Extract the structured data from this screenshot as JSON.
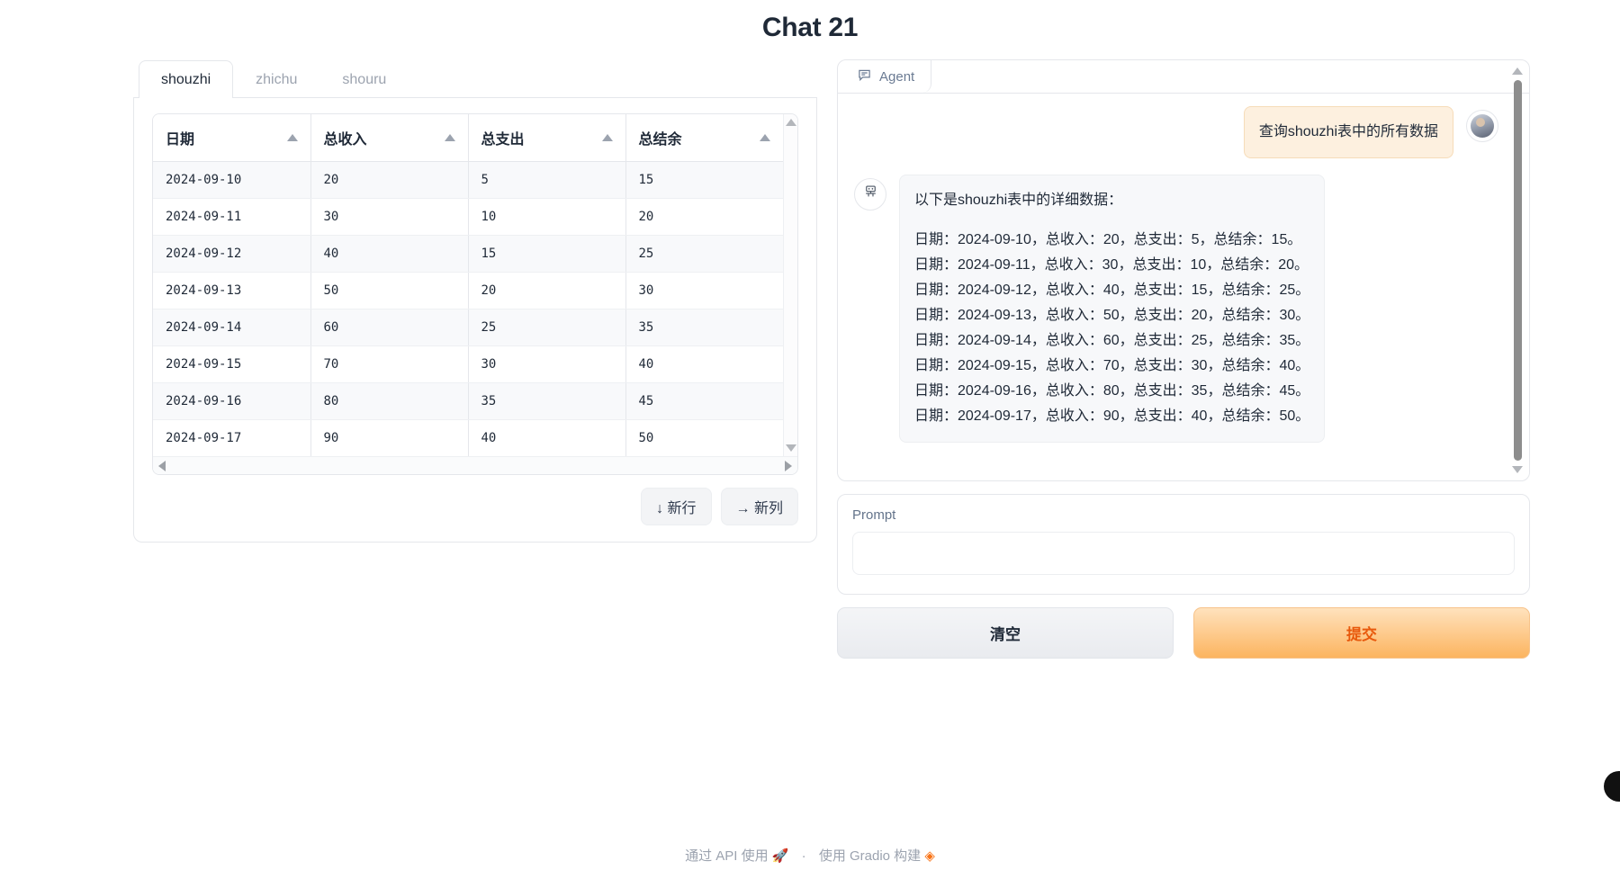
{
  "app": {
    "title": "Chat 21"
  },
  "table_panel": {
    "tabs": [
      {
        "label": "shouzhi",
        "active": true
      },
      {
        "label": "zhichu",
        "active": false
      },
      {
        "label": "shouru",
        "active": false
      }
    ],
    "dataframe": {
      "columns": [
        "日期",
        "总收入",
        "总支出",
        "总结余"
      ],
      "rows": [
        [
          "2024-09-10",
          "20",
          "5",
          "15"
        ],
        [
          "2024-09-11",
          "30",
          "10",
          "20"
        ],
        [
          "2024-09-12",
          "40",
          "15",
          "25"
        ],
        [
          "2024-09-13",
          "50",
          "20",
          "30"
        ],
        [
          "2024-09-14",
          "60",
          "25",
          "35"
        ],
        [
          "2024-09-15",
          "70",
          "30",
          "40"
        ],
        [
          "2024-09-16",
          "80",
          "35",
          "45"
        ],
        [
          "2024-09-17",
          "90",
          "40",
          "50"
        ]
      ]
    },
    "new_row_button": "↓  新行",
    "new_col_button": "→  新列"
  },
  "chat": {
    "tab_label": "Agent",
    "messages": [
      {
        "role": "user",
        "text": "查询shouzhi表中的所有数据"
      },
      {
        "role": "bot",
        "intro": "以下是shouzhi表中的详细数据：",
        "lines": [
          "日期：2024-09-10，总收入：20，总支出：5，总结余：15。",
          "日期：2024-09-11，总收入：30，总支出：10，总结余：20。",
          "日期：2024-09-12，总收入：40，总支出：15，总结余：25。",
          "日期：2024-09-13，总收入：50，总支出：20，总结余：30。",
          "日期：2024-09-14，总收入：60，总支出：25，总结余：35。",
          "日期：2024-09-15，总收入：70，总支出：30，总结余：40。",
          "日期：2024-09-16，总收入：80，总支出：35，总结余：45。",
          "日期：2024-09-17，总收入：90，总支出：40，总结余：50。"
        ]
      }
    ]
  },
  "prompt": {
    "label": "Prompt",
    "value": "",
    "placeholder": ""
  },
  "buttons": {
    "clear": "清空",
    "submit": "提交"
  },
  "footer": {
    "api_text": "通过 API 使用",
    "separator": "·",
    "built_text": "使用 Gradio 构建"
  },
  "colors": {
    "accent_orange": "#f97316",
    "submit_text": "#e8590c",
    "user_bubble": "#fdf0df",
    "bot_bubble": "#f7f8fa",
    "title": "#1f2937"
  }
}
